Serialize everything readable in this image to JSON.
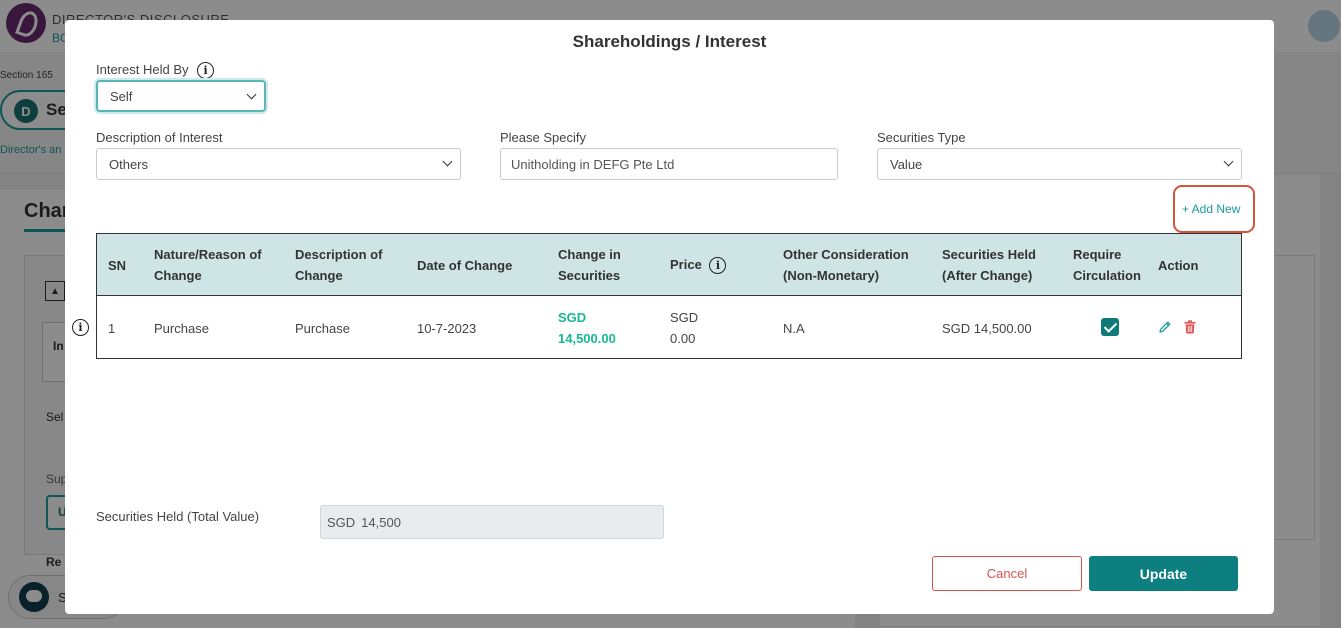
{
  "background": {
    "app_title": "DIRECTOR'S DISCLOSURE",
    "app_subtitle": "BO",
    "section_label": "Section 165",
    "pill_badge": "D",
    "pill_label": "Se",
    "note_text": "Director's an",
    "card_heading": "Char",
    "inner_tab": "In",
    "select_text": "Sel",
    "sup_text": "Sup",
    "u_button": "U",
    "rer_text": "Re",
    "chat_label": "S"
  },
  "modal": {
    "title": "Shareholdings / Interest",
    "interest_held_by": {
      "label": "Interest Held By",
      "value": "Self"
    },
    "description_of_interest": {
      "label": "Description of Interest",
      "value": "Others"
    },
    "please_specify": {
      "label": "Please Specify",
      "value": "Unitholding in DEFG Pte Ltd"
    },
    "securities_type": {
      "label": "Securities Type",
      "value": "Value"
    },
    "add_new_label": "+ Add New",
    "table": {
      "headers": {
        "sn": "SN",
        "nature_1": "Nature/Reason of",
        "nature_2": "Change",
        "desc_1": "Description of",
        "desc_2": "Change",
        "date": "Date of Change",
        "chg_1": "Change in",
        "chg_2": "Securities",
        "price": "Price",
        "other_1": "Other Consideration",
        "other_2": "(Non-Monetary)",
        "held_1": "Securities Held",
        "held_2": "(After Change)",
        "circ_1": "Require",
        "circ_2": "Circulation",
        "action": "Action"
      },
      "rows": [
        {
          "sn": "1",
          "nature": "Purchase",
          "description": "Purchase",
          "date": "10-7-2023",
          "change_currency": "SGD",
          "change_amount": "14,500.00",
          "price_currency": "SGD",
          "price_amount": "0.00",
          "other": "N.A",
          "held": "SGD 14,500.00",
          "require_circulation": true
        }
      ]
    },
    "total": {
      "label": "Securities Held (Total Value)",
      "currency": "SGD",
      "value": "14,500"
    },
    "cancel_label": "Cancel",
    "update_label": "Update"
  },
  "colors": {
    "accent": "#0e7f80",
    "highlight_green": "#17b896",
    "danger": "#d9534f",
    "header_bg": "#cfe4e4",
    "annotation_red": "#d6533a"
  }
}
